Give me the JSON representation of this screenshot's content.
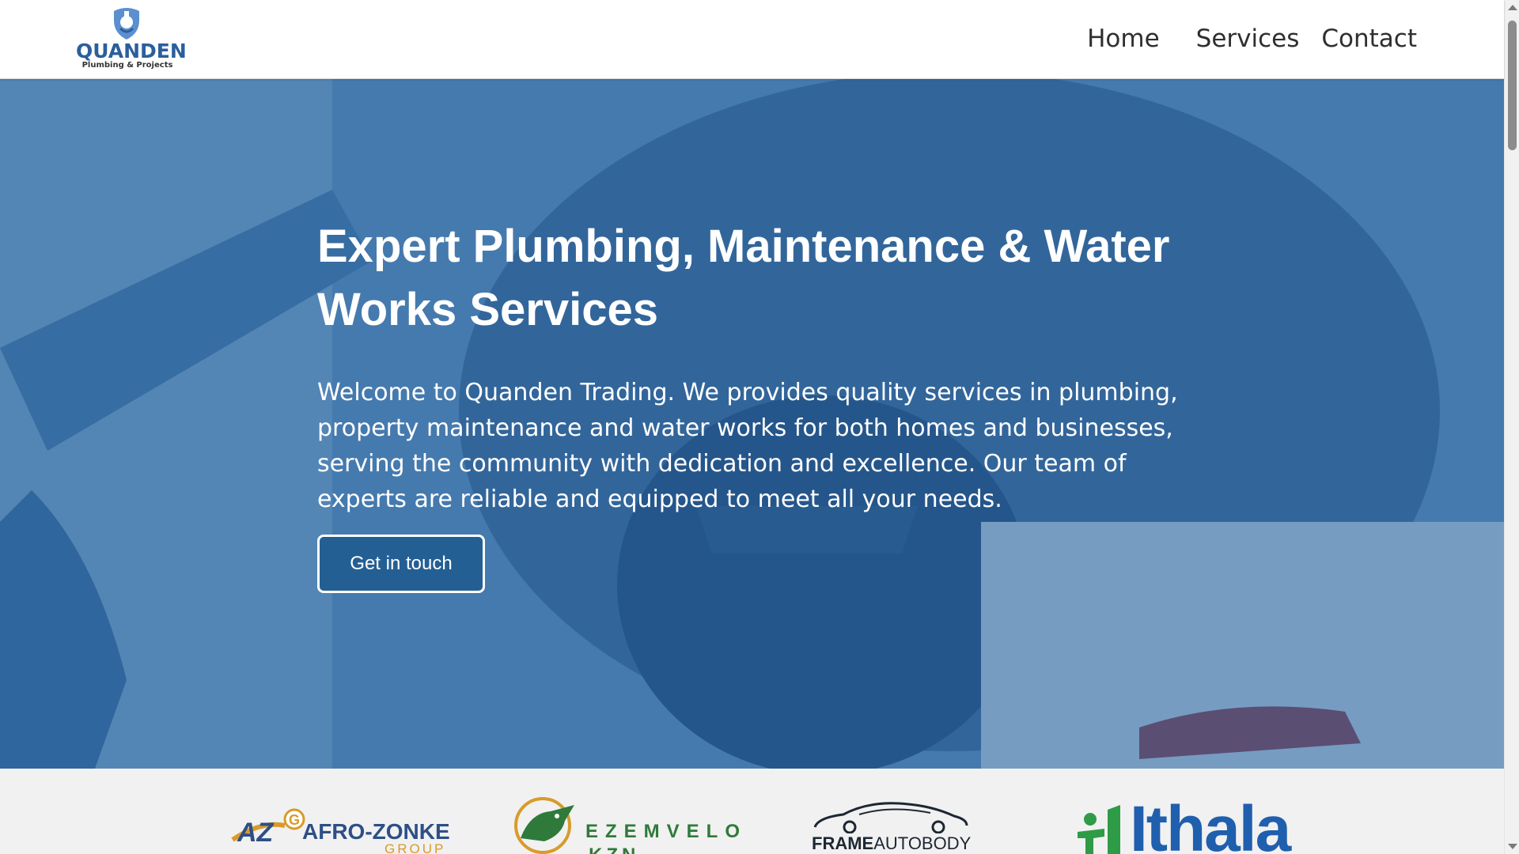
{
  "header": {
    "logo": {
      "name": "QUANDEN",
      "tagline": "Plumbing & Projects",
      "icon": "shield-drop-icon",
      "color": "#2a5f9c"
    },
    "nav": [
      {
        "label": "Home"
      },
      {
        "label": "Services"
      },
      {
        "label": "Contact"
      }
    ]
  },
  "hero": {
    "title": "Expert Plumbing, Maintenance & Water Works Services",
    "text": "Welcome to Quanden Trading. We provides quality services in plumbing, property maintenance and water works for both homes and businesses, serving the community with dedication and excellence. Our team of experts are reliable and equipped to meet all your needs.",
    "cta_label": "Get in touch",
    "overlay_color": "#235f9b",
    "cta_color": "#245f94"
  },
  "partners": [
    {
      "name": "AFRO-ZONKE",
      "sub": "GROUP",
      "mark": "AZG"
    },
    {
      "name": "EZEMVELO",
      "sub": "KZN WILDLIFE",
      "mark": "rhino-icon"
    },
    {
      "name_bold": "FRAME",
      "name_light": "AUTOBODY",
      "mark": "car-icon"
    },
    {
      "name": "Ithala",
      "mark": "people-icon"
    }
  ]
}
